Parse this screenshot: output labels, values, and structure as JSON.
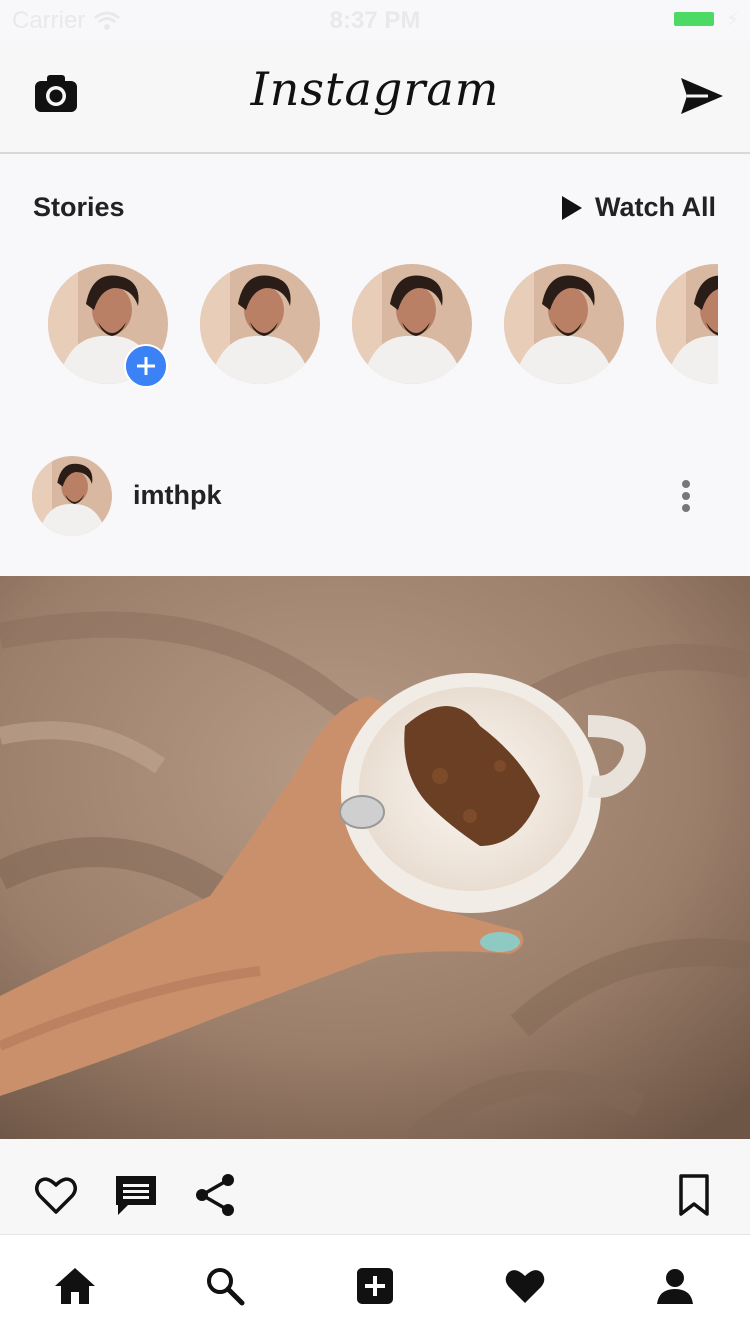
{
  "status_bar": {
    "carrier": "Carrier",
    "time": "8:37 PM",
    "battery_color": "#4cd964"
  },
  "navbar": {
    "logo": "Instagram",
    "left_icon": "camera-icon",
    "right_icon": "send-icon"
  },
  "stories": {
    "title": "Stories",
    "watch_all_label": "Watch All",
    "items": [
      {
        "type": "own-story",
        "has_add_badge": true
      },
      {
        "type": "story"
      },
      {
        "type": "story"
      },
      {
        "type": "story"
      },
      {
        "type": "story",
        "partially_visible": true
      }
    ],
    "add_badge_color": "#3b82f6"
  },
  "post": {
    "username": "imthpk",
    "menu_icon": "more-vertical-icon",
    "image_subject": "hand-holding-coffee-cup",
    "actions": {
      "left": [
        "heart-icon",
        "comment-icon",
        "share-icon"
      ],
      "right": "bookmark-icon"
    }
  },
  "tabbar": {
    "tabs": [
      "home-icon",
      "search-icon",
      "add-icon",
      "activity-heart-icon",
      "profile-icon"
    ]
  }
}
